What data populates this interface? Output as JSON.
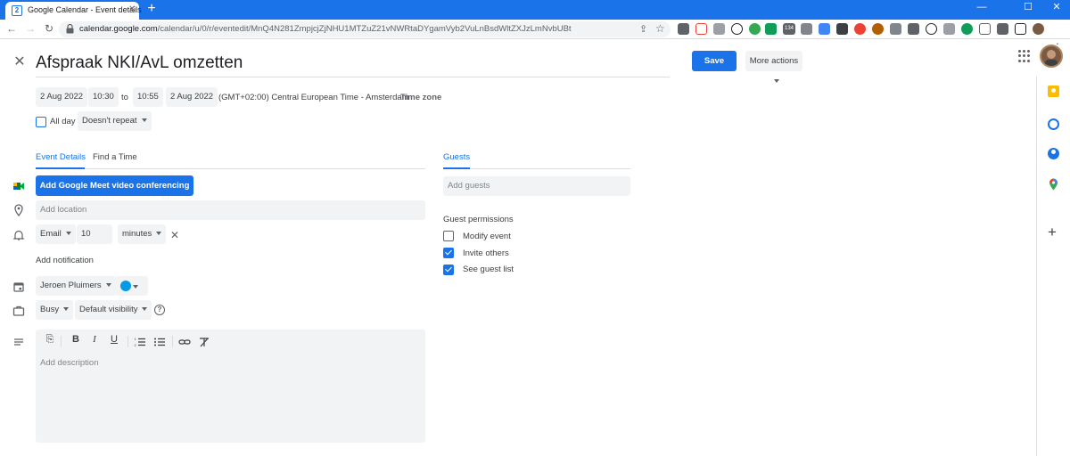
{
  "browser": {
    "tab_title": "Google Calendar - Event details",
    "tab_favicon_text": "2",
    "url_host": "calendar.google.com",
    "url_path": "/calendar/u/0/r/eventedit/MnQ4N281ZmpjcjZjNHU1MTZuZ21vNWRtaDYgamVyb2VuLnBsdWltZXJzLmNvbUBt",
    "extension_badge": "134"
  },
  "event": {
    "title": "Afspraak NKI/AvL omzetten",
    "save_label": "Save",
    "more_actions_label": "More actions",
    "start_date": "2 Aug 2022",
    "start_time": "10:30",
    "to_label": "to",
    "end_time": "10:55",
    "end_date": "2 Aug 2022",
    "timezone_text": "(GMT+02:00) Central European Time - Amsterdam",
    "timezone_link": "Time zone",
    "allday_label": "All day",
    "repeat_label": "Doesn't repeat"
  },
  "tabs": {
    "event_details": "Event Details",
    "find_time": "Find a Time",
    "guests": "Guests"
  },
  "details": {
    "meet_button": "Add Google Meet video conferencing",
    "location_placeholder": "Add location",
    "notif_type": "Email",
    "notif_value": "10",
    "notif_unit": "minutes",
    "add_notification": "Add notification",
    "calendar_owner": "Jeroen Pluimers",
    "calendar_color": "#039be5",
    "busy_label": "Busy",
    "visibility_label": "Default visibility",
    "description_placeholder": "Add description"
  },
  "guests": {
    "add_guests_placeholder": "Add guests",
    "permissions_heading": "Guest permissions",
    "permissions": [
      {
        "label": "Modify event",
        "checked": false
      },
      {
        "label": "Invite others",
        "checked": true
      },
      {
        "label": "See guest list",
        "checked": true
      }
    ]
  },
  "colors": {
    "accent": "#1a73e8",
    "chip_bg": "#f1f3f4"
  },
  "icons": [
    "back-icon",
    "forward-icon",
    "reload-icon",
    "lock-icon",
    "share-icon",
    "star-icon",
    "close-icon",
    "meet-icon",
    "location-icon",
    "bell-icon",
    "calendar-icon",
    "briefcase-icon",
    "help-icon",
    "text-align-icon",
    "attachment-icon",
    "bold-icon",
    "italic-icon",
    "underline-icon",
    "numbered-list-icon",
    "bulleted-list-icon",
    "link-icon",
    "clear-format-icon",
    "apps-grid-icon",
    "keep-icon",
    "tasks-icon",
    "contacts-icon",
    "maps-icon",
    "plus-icon"
  ]
}
